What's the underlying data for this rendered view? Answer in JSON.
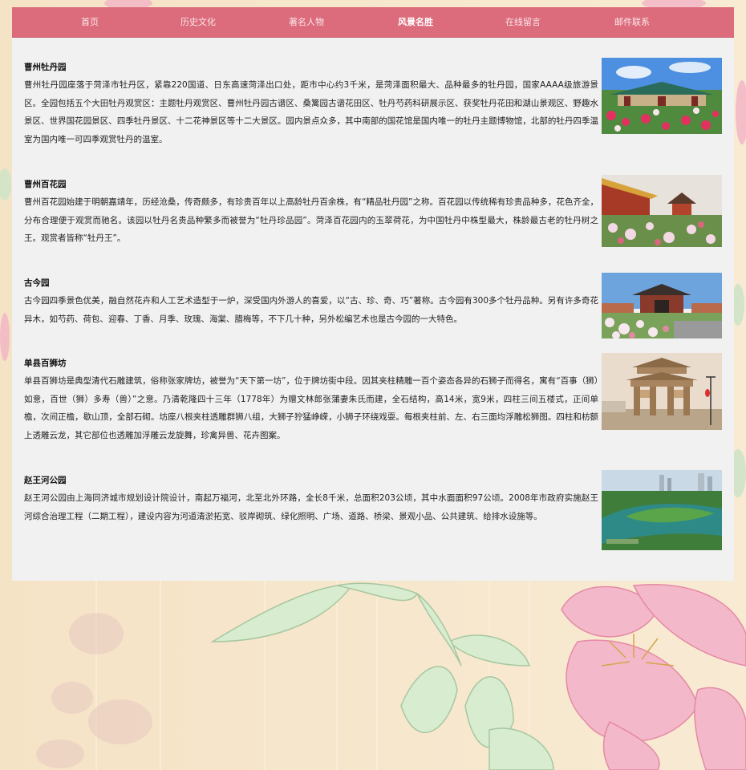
{
  "nav": {
    "items": [
      {
        "label": "首页"
      },
      {
        "label": "历史文化"
      },
      {
        "label": "著名人物"
      },
      {
        "label": "风景名胜"
      },
      {
        "label": "在线留言"
      },
      {
        "label": "邮件联系"
      }
    ],
    "active_index": 3,
    "bar_color": "#dc6c7c"
  },
  "sections": [
    {
      "title": "曹州牡丹园",
      "text": "曹州牡丹园座落于菏泽市牡丹区，紧靠220国道、日东高速菏泽出口处，距市中心约3千米，是菏泽面积最大、品种最多的牡丹园，国家AAAA级旅游景区。全园包括五个大田牡丹观赏区：主题牡丹观赏区、曹州牡丹园古谱区、桑篱园古谱花田区、牡丹芍药科研展示区、获奖牡丹花田和湖山景观区、野趣水景区、世界国花园景区、四季牡丹景区、十二花神景区等十二大景区。园内景点众多，其中南部的国花馆是国内唯一的牡丹主题博物馆，北部的牡丹四季温室为国内唯一可四季观赏牡丹的温室。"
    },
    {
      "title": "曹州百花园",
      "text": "曹州百花园始建于明朝嘉靖年，历经沧桑，传奇颇多，有珍贵百年以上高龄牡丹百余株，有“精品牡丹园”之称。百花园以传统稀有珍贵品种多，花色齐全，分布合理便于观赏而驰名。该园以牡丹名贵品种繁多而被誉为“牡丹珍品园”。菏泽百花园内的玉翠荷花，为中国牡丹中株型最大，株龄最古老的牡丹树之王。观赏者皆称“牡丹王”。"
    },
    {
      "title": "古今园",
      "text": "古今园四季景色优美，融自然花卉和人工艺术造型于一炉，深受国内外游人的喜爱，以“古、珍、奇、巧”著称。古今园有300多个牡丹品种。另有许多奇花异木，如芍药、荷包、迎春、丁香、月季、玫瑰、海棠、腊梅等，不下几十种，另外松编艺术也是古今园的一大特色。"
    },
    {
      "title": "单县百狮坊",
      "text": "单县百狮坊是典型清代石雕建筑，俗称张家牌坊，被誉为“天下第一坊”，位于牌坊街中段。因其夹柱精雕一百个姿态各异的石狮子而得名，寓有“百事（狮）如意，百世（狮）多寿（兽）”之意。乃清乾隆四十三年（1778年）为赠文林郎张蒲妻朱氏而建，全石结构，高14米，宽9米，四柱三间五楼式，正间单檐，次间正檐，歇山顶，全部石砌。坊座八根夹柱透雕群狮八组，大狮子狞猛峥嵘，小狮子环绕戏耍。每根夹柱前、左、右三面均浮雕松狮图。四柱和枋额上透雕云龙，其它部位也透雕加浮雕云龙旋舞，珍禽异兽、花卉图案。"
    },
    {
      "title": "赵王河公园",
      "text": "赵王河公园由上海同济城市规划设计院设计，南起万福河，北至北外环路，全长8千米，总面积203公顷，其中水面面积97公顷。2008年市政府实施赵王河综合治理工程（二期工程），建设内容为河道清淤拓宽、驳岸砌筑、绿化照明、广场、道路、桥梁、景观小品、公共建筑、给排水设施等。"
    }
  ]
}
